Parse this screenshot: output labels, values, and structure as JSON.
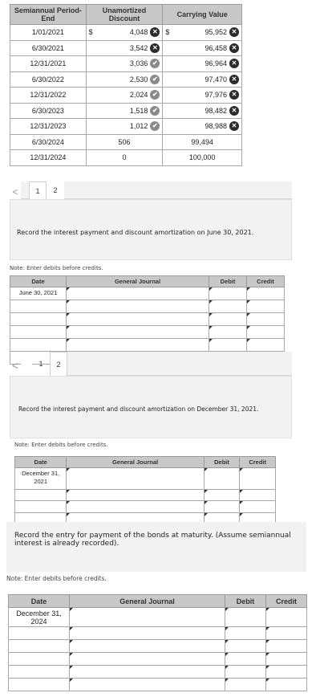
{
  "amortization": {
    "headers": [
      "Semiannual Period-End",
      "Unamortized Discount",
      "Carrying Value"
    ],
    "rows": [
      {
        "period": "1/01/2021",
        "discount": "4,048",
        "discount_mark": "x",
        "carrying": "95,952",
        "carrying_mark": "x",
        "dollar": true
      },
      {
        "period": "6/30/2021",
        "discount": "3,542",
        "discount_mark": "x",
        "carrying": "96,458",
        "carrying_mark": "x",
        "dollar": false
      },
      {
        "period": "12/31/2021",
        "discount": "3,036",
        "discount_mark": "ok",
        "carrying": "96,964",
        "carrying_mark": "x",
        "dollar": false
      },
      {
        "period": "6/30/2022",
        "discount": "2,530",
        "discount_mark": "ok",
        "carrying": "97,470",
        "carrying_mark": "x",
        "dollar": false
      },
      {
        "period": "12/31/2022",
        "discount": "2,024",
        "discount_mark": "ok",
        "carrying": "97,976",
        "carrying_mark": "x",
        "dollar": false
      },
      {
        "period": "6/30/2023",
        "discount": "1,518",
        "discount_mark": "ok",
        "carrying": "98,482",
        "carrying_mark": "x",
        "dollar": false
      },
      {
        "period": "12/31/2023",
        "discount": "1,012",
        "discount_mark": "ok",
        "carrying": "98,988",
        "carrying_mark": "x",
        "dollar": false
      },
      {
        "period": "6/30/2024",
        "discount": "506",
        "discount_mark": "",
        "carrying": "99,494",
        "carrying_mark": "",
        "dollar": false
      },
      {
        "period": "12/31/2024",
        "discount": "0",
        "discount_mark": "",
        "carrying": "100,000",
        "carrying_mark": "",
        "dollar": false
      }
    ],
    "currency_symbol": "$",
    "mark_icons": {
      "x": "close-circle-icon",
      "ok": "check-circle-icon"
    }
  },
  "panel1": {
    "tabs": [
      "1",
      "2"
    ],
    "prev_arrow": "<",
    "question": "Record the interest payment and discount amortization on June 30, 2021.",
    "note": "Note: Enter debits before credits.",
    "headers": [
      "Date",
      "General Journal",
      "Debit",
      "Credit"
    ],
    "date": "June 30, 2021"
  },
  "panel2": {
    "tabs": [
      "1",
      "2"
    ],
    "prev_arrow": "<",
    "question": "Record the interest payment and discount amortization on December 31, 2021.",
    "note": "Note: Enter debits before credits.",
    "headers": [
      "Date",
      "General Journal",
      "Debit",
      "Credit"
    ],
    "date": "December 31, 2021"
  },
  "panel3": {
    "question": "Record the entry for payment of the bonds at maturity. (Assume semiannual interest is already recorded).",
    "note": "Note: Enter debits before credits.",
    "headers": [
      "Date",
      "General Journal",
      "Debit",
      "Credit"
    ],
    "date": "December 31, 2024"
  }
}
